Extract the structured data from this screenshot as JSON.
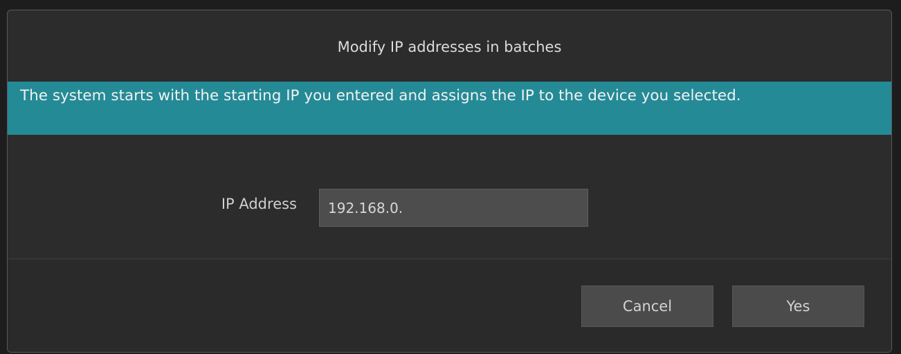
{
  "dialog": {
    "title": "Modify IP addresses in batches",
    "info_message": "The system starts with the starting IP you entered and assigns the IP to the device you selected.",
    "form": {
      "ip_label": "IP Address",
      "ip_value": "192.168.0."
    },
    "buttons": {
      "cancel_label": "Cancel",
      "yes_label": "Yes"
    }
  },
  "colors": {
    "dialog_background": "#2c2c2c",
    "banner": "#248a96",
    "input_background": "#4d4d4d",
    "button_background": "#4b4b4b"
  }
}
